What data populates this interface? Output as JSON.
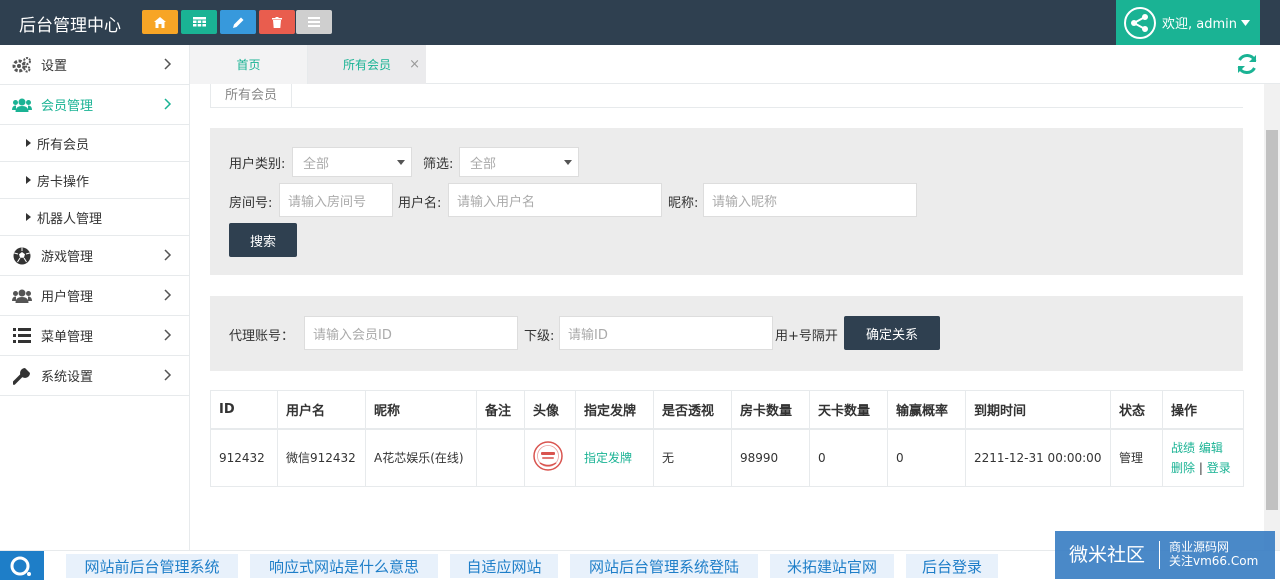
{
  "app": {
    "title": "后台管理中心"
  },
  "colors": {
    "topbar": "#2f4050",
    "accent": "#1ab394",
    "dark_button": "#2f4050"
  },
  "toolbar": [
    {
      "icon": "home-icon",
      "color": "#f7a526"
    },
    {
      "icon": "table-icon",
      "color": "#1ab394"
    },
    {
      "icon": "pencil-icon",
      "color": "#3799dc"
    },
    {
      "icon": "trash-icon",
      "color": "#e95d4e"
    },
    {
      "icon": "menu-icon",
      "color": "#cfcfcf"
    }
  ],
  "user": {
    "greeting": "欢迎, admin"
  },
  "sidebar": {
    "items": [
      {
        "label": "设置",
        "icon": "cogs-icon"
      },
      {
        "label": "会员管理",
        "icon": "users-icon",
        "active": true,
        "children": [
          "所有会员",
          "房卡操作",
          "机器人管理"
        ]
      },
      {
        "label": "游戏管理",
        "icon": "soccer-icon"
      },
      {
        "label": "用户管理",
        "icon": "users-icon"
      },
      {
        "label": "菜单管理",
        "icon": "list-icon"
      },
      {
        "label": "系统设置",
        "icon": "wrench-icon"
      }
    ]
  },
  "tabs": [
    {
      "label": "首页"
    },
    {
      "label": "所有会员",
      "closable": true
    }
  ],
  "content_tab": {
    "label": "所有会员"
  },
  "search": {
    "user_type_label": "用户类别:",
    "user_type_value": "全部",
    "filter_label": "筛选:",
    "filter_value": "全部",
    "room_label": "房间号:",
    "room_placeholder": "请输入房间号",
    "username_label": "用户名:",
    "username_placeholder": "请输入用户名",
    "nickname_label": "昵称:",
    "nickname_placeholder": "请输入昵称",
    "search_button": "搜索"
  },
  "agent": {
    "account_label": "代理账号：",
    "account_placeholder": "请输入会员ID",
    "sub_label": "下级:",
    "sub_placeholder": "请输ID",
    "hint": "用+号隔开",
    "confirm_button": "确定关系"
  },
  "table": {
    "headers": [
      "ID",
      "用户名",
      "昵称",
      "备注",
      "头像",
      "指定发牌",
      "是否透视",
      "房卡数量",
      "天卡数量",
      "输赢概率",
      "到期时间",
      "状态",
      "操作"
    ],
    "rows": [
      {
        "id": "912432",
        "username": "微信912432",
        "nickname": "A花芯娱乐(在线)",
        "note": "",
        "deal": "指定发牌",
        "xray": "无",
        "room_cards": "98990",
        "day_cards": "0",
        "win_rate": "0",
        "expire": "2211-12-31 00:00:00",
        "status": "管理",
        "ops": {
          "stats": "战绩",
          "edit": "编辑",
          "delete": "删除",
          "sep": "|",
          "login": "登录"
        }
      }
    ]
  },
  "bottom_links": [
    "网站前后台管理系统",
    "响应式网站是什么意思",
    "自适应网站",
    "网站后台管理系统登陆",
    "米拓建站官网",
    "后台登录"
  ],
  "watermark": {
    "name": "微米社区",
    "line1": "商业源码网",
    "line2": "关注vm66.Com"
  }
}
